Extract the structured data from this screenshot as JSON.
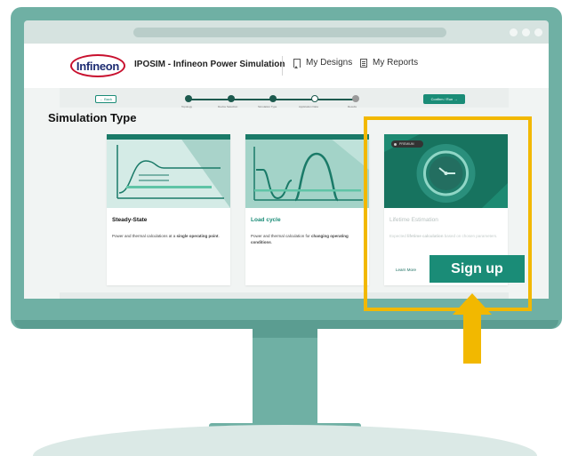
{
  "header": {
    "logo_text": "Infineon",
    "app_title": "IPOSIM - Infineon Power Simulation",
    "nav": [
      {
        "label": "My Designs",
        "icon": "bookmark-icon"
      },
      {
        "label": "My Reports",
        "icon": "report-icon"
      }
    ]
  },
  "stepper": {
    "back_label": "← Back",
    "steps": [
      "Topology",
      "Device Selection",
      "Simulation Type",
      "Application Data",
      "Results"
    ],
    "confirm_label": "Confirm / Run →"
  },
  "section_title": "Simulation Type",
  "cards": [
    {
      "title": "Steady-State",
      "desc_pre": "Power and thermal calculations at a ",
      "desc_bold": "single operating point",
      "desc_post": "."
    },
    {
      "title": "Load cycle",
      "desc_pre": "Power and thermal calculation for ",
      "desc_bold": "changing operating conditions",
      "desc_post": "."
    },
    {
      "title": "Lifetime Estimation",
      "desc_pre": "Expected ",
      "desc_bold": "lifetime calculation",
      "desc_post": " based on chosen parameters.",
      "badge": "PREMIUM",
      "learn_more": "Learn More"
    }
  ],
  "callout": {
    "signup_label": "Sign up"
  },
  "colors": {
    "accent": "#1a8c77",
    "monitor": "#6fb0a4",
    "highlight": "#f2b800"
  }
}
